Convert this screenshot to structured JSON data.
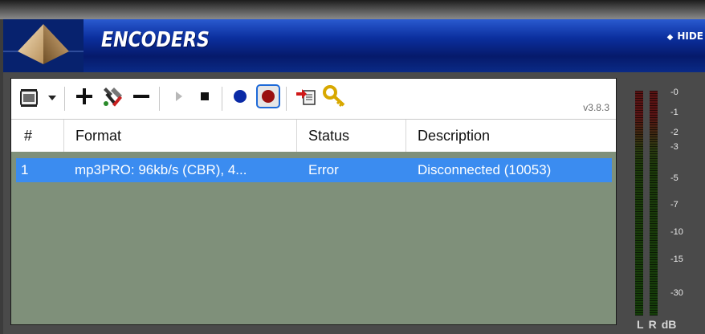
{
  "header": {
    "title": "ENCODERS",
    "hide_label": "HIDE"
  },
  "toolbar": {
    "icons": [
      "encoder-config-icon",
      "dropdown-arrow-icon",
      "add-icon",
      "tools-icon",
      "remove-icon",
      "play-icon",
      "stop-icon",
      "blue-dot-icon",
      "record-icon",
      "export-icon",
      "key-icon"
    ],
    "version": "v3.8.3"
  },
  "table": {
    "columns": [
      "#",
      "Format",
      "Status",
      "Description"
    ],
    "rows": [
      {
        "num": "1",
        "format": "mp3PRO: 96kb/s (CBR), 4...",
        "status": "Error",
        "description": "Disconnected (10053)"
      }
    ]
  },
  "meter": {
    "scale": [
      "-0",
      "-1",
      "-2",
      "-3",
      "-5",
      "-7",
      "-10",
      "-15",
      "-30"
    ],
    "channel_left": "L",
    "channel_right": "R",
    "unit": "dB"
  },
  "colors": {
    "header_blue": "#0b2f9e",
    "selection": "#3b8cf0",
    "list_background": "#7f907a"
  }
}
